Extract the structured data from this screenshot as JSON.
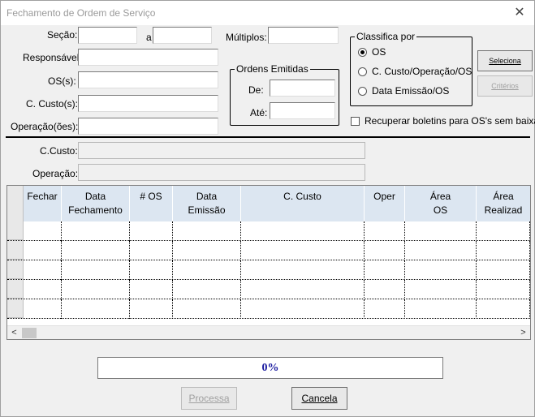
{
  "window": {
    "title": "Fechamento de Ordem de Serviço",
    "close_glyph": "✕"
  },
  "filters": {
    "secao_label": "Seção:",
    "a_label": "a",
    "multiplos_label": "Múltiplos:",
    "responsavel_label": "Responsável",
    "os_label": "OS(s):",
    "ccusto_label": "C. Custo(s):",
    "operacao_label": "Operação(ões):",
    "secao_from": "",
    "secao_to": "",
    "multiplos": "",
    "responsavel": "",
    "os": "",
    "ccusto": "",
    "operacao": ""
  },
  "ordens_emitidas": {
    "title": "Ordens Emitidas",
    "de_label": "De:",
    "ate_label": "Até:",
    "de": "",
    "ate": ""
  },
  "classifica": {
    "title": "Classifica por",
    "options": [
      "OS",
      "C. Custo/Operação/OS",
      "Data Emissão/OS"
    ],
    "selected": 0
  },
  "buttons": {
    "seleciona": "Seleciona",
    "criterios": "Critérios",
    "processa": "Processa",
    "cancela": "Cancela"
  },
  "recuperar_label": "Recuperar boletins para OS's sem baixa",
  "info": {
    "ccusto_label": "C.Custo:",
    "operacao_label": "Operação:",
    "ccusto": "",
    "operacao": ""
  },
  "grid": {
    "columns": [
      {
        "line1": "Fechar",
        "line2": ""
      },
      {
        "line1": "Data",
        "line2": "Fechamento"
      },
      {
        "line1": "# OS",
        "line2": ""
      },
      {
        "line1": "Data",
        "line2": "Emissão"
      },
      {
        "line1": "C. Custo",
        "line2": ""
      },
      {
        "line1": "Oper",
        "line2": ""
      },
      {
        "line1": "Área",
        "line2": "OS"
      },
      {
        "line1": "Área",
        "line2": "Realizad"
      }
    ],
    "row_count": 5
  },
  "progress": {
    "percent": 0,
    "text": "0%"
  },
  "scroll": {
    "left_glyph": "<",
    "right_glyph": ">"
  }
}
